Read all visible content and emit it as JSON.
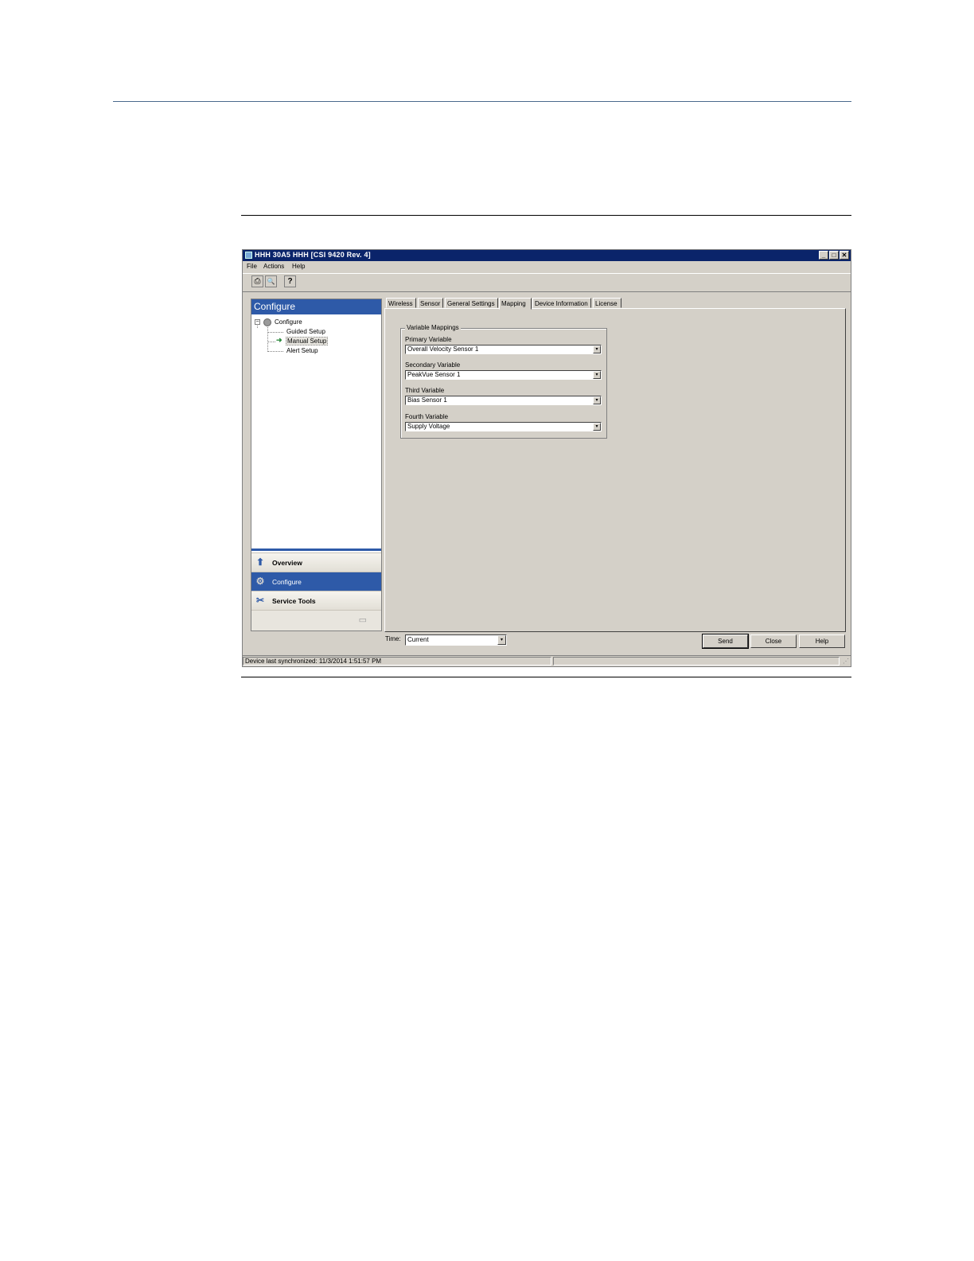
{
  "window": {
    "title": "HHH 30A5 HHH [CSI 9420 Rev. 4]",
    "controls": {
      "minimize": "_",
      "maximize": "□",
      "close": "✕"
    }
  },
  "menu": [
    "File",
    "Actions",
    "Help"
  ],
  "toolbar": {
    "buttons": [
      {
        "icon": "print-icon",
        "glyph": "⎙"
      },
      {
        "icon": "print-preview-icon",
        "glyph": "🔍"
      },
      {
        "icon": "help-pointer-icon",
        "glyph": "?"
      }
    ]
  },
  "left_panel": {
    "header": "Configure",
    "tree": {
      "root": "Configure",
      "root_expander": "−",
      "children": [
        "Guided Setup",
        "Manual Setup",
        "Alert Setup"
      ],
      "selected": "Manual Setup"
    },
    "nav": [
      {
        "label": "Overview",
        "icon": "overview-up-arrow-icon",
        "glyph": "⬆"
      },
      {
        "label": "Configure",
        "icon": "configure-gear-icon",
        "glyph": "⚙"
      },
      {
        "label": "Service Tools",
        "icon": "service-tools-icon",
        "glyph": "✂"
      }
    ],
    "footer_icon": "panel-options-icon",
    "footer_glyph": "▭"
  },
  "tabs": [
    "Wireless",
    "Sensor",
    "General Settings",
    "Mapping",
    "Device Information",
    "License"
  ],
  "active_tab": "Mapping",
  "mapping": {
    "group_title": "Variable Mappings",
    "fields": [
      {
        "label": "Primary Variable",
        "value": "Overall Velocity Sensor 1"
      },
      {
        "label": "Secondary Variable",
        "value": "PeakVue Sensor 1"
      },
      {
        "label": "Third Variable",
        "value": "Bias Sensor 1"
      },
      {
        "label": "Fourth Variable",
        "value": "Supply Voltage"
      }
    ],
    "dropdown_glyph": "▾"
  },
  "footer": {
    "time_label": "Time:",
    "time_value": "Current",
    "buttons": [
      "Send",
      "Close",
      "Help"
    ]
  },
  "status": {
    "text": "Device last synchronized: 11/3/2014 1:51:57 PM"
  },
  "colors": {
    "titlebar": "#0a246a",
    "panel_header": "#2e5aa8",
    "window_face": "#d4d0c8"
  }
}
